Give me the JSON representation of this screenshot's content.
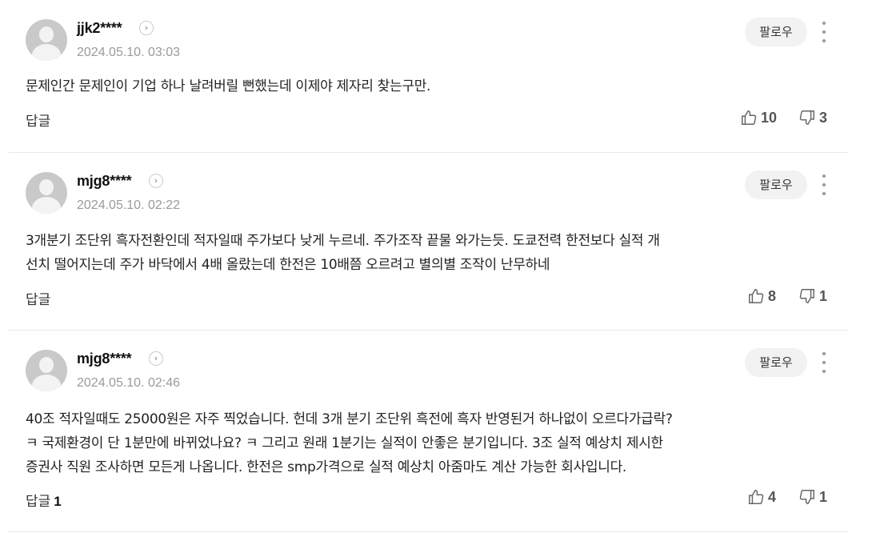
{
  "comments": [
    {
      "username": "jjk2****",
      "date": "2024.05.10. 03:03",
      "follow_label": "팔로우",
      "text": "문제인간 문제인이 기업 하나 날려버릴 뻔했는데 이제야 제자리 찾는구만.",
      "reply_label": "답글",
      "reply_count": "",
      "likes": "10",
      "dislikes": "3"
    },
    {
      "username": "mjg8****",
      "date": "2024.05.10. 02:22",
      "follow_label": "팔로우",
      "text": "3개분기 조단위 흑자전환인데 적자일때 주가보다 낮게 누르네. 주가조작 끝물 와가는듯. 도쿄전력 한전보다 실적 개\n선치 떨어지는데 주가 바닥에서 4배 올랐는데 한전은 10배쯤 오르려고 별의별 조작이 난무하네",
      "reply_label": "답글",
      "reply_count": "",
      "likes": "8",
      "dislikes": "1"
    },
    {
      "username": "mjg8****",
      "date": "2024.05.10. 02:46",
      "follow_label": "팔로우",
      "text": "40조 적자일때도 25000원은 자주 찍었습니다. 헌데 3개 분기 조단위 흑전에 흑자 반영된거 하나없이 오르다가급락?\nㅋ 국제환경이 단 1분만에 바뀌었나요? ㅋ 그리고 원래 1분기는 실적이 안좋은 분기입니다. 3조 실적 예상치 제시한\n증권사 직원 조사하면 모든게 나옵니다. 한전은 smp가격으로 실적 예상치 아줌마도 계산 가능한 회사입니다.",
      "reply_label": "답글",
      "reply_count": "1",
      "likes": "4",
      "dislikes": "1"
    }
  ],
  "icons": {
    "profile": "profile-icon",
    "chevron": "chevron-right-icon",
    "more": "more-vertical-icon",
    "like": "thumbs-up-icon",
    "dislike": "thumbs-down-icon"
  }
}
